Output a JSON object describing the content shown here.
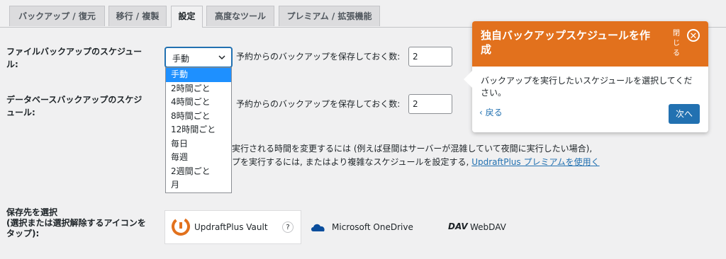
{
  "tabs": [
    {
      "label": "バックアップ / 復元"
    },
    {
      "label": "移行 / 複製"
    },
    {
      "label": "設定"
    },
    {
      "label": "高度なツール"
    },
    {
      "label": "プレミアム / 拡張機能"
    }
  ],
  "file_backup": {
    "label_line1": "ファイルバックアップのスケジュー",
    "label_line2": "ル:",
    "schedule_value": "手動",
    "retain_label": "予約からのバックアップを保存しておく数:",
    "retain_value": "2"
  },
  "schedule_options": [
    "手動",
    "2時間ごと",
    "4時間ごと",
    "8時間ごと",
    "12時間ごと",
    "毎日",
    "毎週",
    "2週間ごと",
    "月"
  ],
  "db_backup": {
    "label_line1": "データベースバックアップのスケジ",
    "label_line2": "ュール:",
    "retain_label": "予約からのバックアップを保存しておく数:",
    "retain_value": "2"
  },
  "info_text": {
    "line1": "実行される時間を変更するには (例えば昼間はサーバーが混雑していて夜間に実行したい場合),",
    "line2_prefix": "プを実行するには, またはより複雑なスケジュールを設定する, ",
    "line2_link": "UpdraftPlus プレミアムを使用く"
  },
  "storage": {
    "label_line1": "保存先を選択",
    "label_line2": "(選択または選択解除するアイコンを",
    "label_line3": "タップ):",
    "items": [
      {
        "label": "UpdraftPlus Vault",
        "help": "?"
      },
      {
        "label": "Microsoft OneDrive"
      },
      {
        "label": "WebDAV",
        "icon_text": "DAV"
      }
    ]
  },
  "tooltip": {
    "title": "独自バックアップスケジュールを作成",
    "close_label": "閉じる",
    "body": "バックアップを実行したいスケジュールを選択してください。",
    "back_label": "‹ 戻る",
    "next_label": "次へ"
  },
  "colors": {
    "accent": "#e2711d",
    "primary": "#2271b1",
    "selected_option": "#1e90ff"
  }
}
